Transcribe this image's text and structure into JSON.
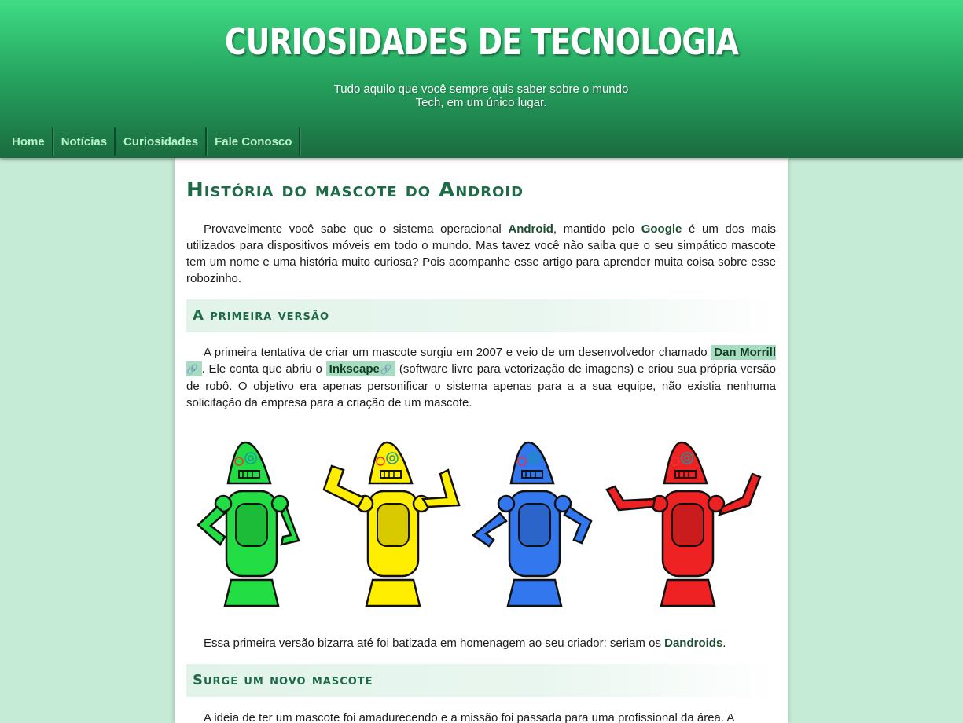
{
  "header": {
    "title": "CURIOSIDADES DE TECNOLOGIA",
    "tagline": "Tudo aquilo que você sempre quis saber sobre o mundo Tech, em um único lugar."
  },
  "nav": {
    "items": [
      {
        "label": "Home"
      },
      {
        "label": "Notícias"
      },
      {
        "label": "Curiosidades"
      },
      {
        "label": "Fale Conosco"
      }
    ]
  },
  "article": {
    "title": "História do mascote do Android",
    "intro": {
      "t1": "Provavelmente você sabe que o sistema operacional ",
      "b1": "Android",
      "t2": ", mantido pelo ",
      "b2": "Google",
      "t3": " é um dos mais utilizados para dispositivos móveis em todo o mundo. Mas tavez você não saiba que o seu simpático mascote tem um nome e uma história muito curiosa? Pois acompanhe esse artigo para aprender muita coisa sobre esse robozinho."
    },
    "section1": {
      "heading": "A primeira versão",
      "t1": "A primeira tentativa de criar um mascote surgiu em 2007 e veio de um desenvolvedor chamado ",
      "link1": "Dan Morrill",
      "t2": ". Ele conta que abriu o ",
      "link2": "Inkscape",
      "t3": " (software livre para vetorização de imagens) e criou sua própria versão de robô. O objetivo era apenas personificar o sistema apenas para a a sua equipe, não existia nenhuma solicitação da empresa para a criação de um mascote.",
      "caption_t1": "Essa primeira versão bizarra até foi batizada em homenagem ao seu criador: seriam os ",
      "caption_b1": "Dandroids",
      "caption_t2": "."
    },
    "section2": {
      "heading": "Surge um novo mascote",
      "t1": "A ideia de ter um mascote foi amadurecendo e a missão foi passada para uma profissional da área. A"
    }
  },
  "icons": {
    "link": "link-icon"
  },
  "colors": {
    "header_top": "#3fdc84",
    "header_bottom": "#1a6b3f",
    "page_bg": "#c5ead5",
    "heading": "#1f6a47",
    "link_bg": "#a8dcc0",
    "robot_green": "#22dd44",
    "robot_yellow": "#ffee00",
    "robot_blue": "#3377ee",
    "robot_red": "#ee2222"
  }
}
